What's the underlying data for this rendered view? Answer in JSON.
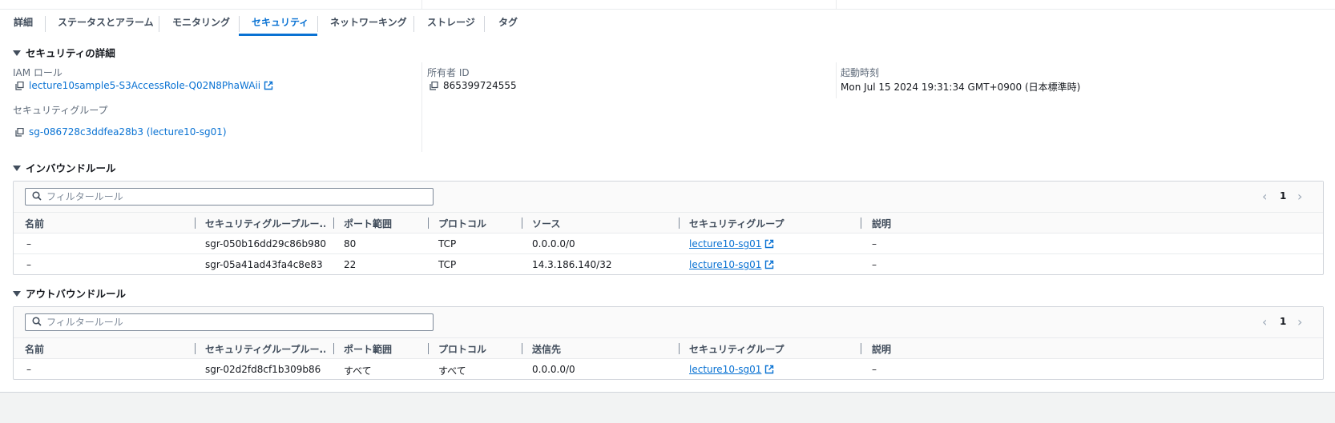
{
  "tabs": [
    {
      "label": "詳細"
    },
    {
      "label": "ステータスとアラーム"
    },
    {
      "label": "モニタリング"
    },
    {
      "label": "セキュリティ"
    },
    {
      "label": "ネットワーキング"
    },
    {
      "label": "ストレージ"
    },
    {
      "label": "タグ"
    }
  ],
  "active_tab": "セキュリティ",
  "security_details": {
    "title": "セキュリティの詳細",
    "iam_role_label": "IAM ロール",
    "iam_role_value": "lecture10sample5-S3AccessRole-Q02N8PhaWAii",
    "owner_id_label": "所有者 ID",
    "owner_id_value": "865399724555",
    "launch_time_label": "起動時刻",
    "launch_time_value": "Mon Jul 15 2024 19:31:34 GMT+0900 (日本標準時)",
    "security_groups_label": "セキュリティグループ",
    "security_group_value": "sg-086728c3ddfea28b3 (lecture10-sg01)"
  },
  "inbound": {
    "title": "インバウンドルール",
    "filter_placeholder": "フィルタールール",
    "page": "1",
    "columns": [
      "名前",
      "セキュリティグループルー...",
      "ポート範囲",
      "プロトコル",
      "ソース",
      "セキュリティグループ",
      "説明"
    ],
    "rows": [
      {
        "name": "–",
        "rule_id": "sgr-050b16dd29c86b980",
        "port": "80",
        "protocol": "TCP",
        "source": "0.0.0.0/0",
        "sg": "lecture10-sg01",
        "desc": "–"
      },
      {
        "name": "–",
        "rule_id": "sgr-05a41ad43fa4c8e83",
        "port": "22",
        "protocol": "TCP",
        "source": "14.3.186.140/32",
        "sg": "lecture10-sg01",
        "desc": "–"
      }
    ]
  },
  "outbound": {
    "title": "アウトバウンドルール",
    "filter_placeholder": "フィルタールール",
    "page": "1",
    "columns": [
      "名前",
      "セキュリティグループルー...",
      "ポート範囲",
      "プロトコル",
      "送信先",
      "セキュリティグループ",
      "説明"
    ],
    "rows": [
      {
        "name": "–",
        "rule_id": "sgr-02d2fd8cf1b309b86",
        "port": "すべて",
        "protocol": "すべて",
        "source": "0.0.0.0/0",
        "sg": "lecture10-sg01",
        "desc": "–"
      }
    ]
  },
  "colors": {
    "link": "#0972d3",
    "text": "#16191f",
    "muted": "#5f6b7a"
  },
  "icons": {
    "copy": "copy-icon",
    "external": "external-link-icon",
    "search": "search-icon",
    "caret": "caret-down-icon"
  }
}
